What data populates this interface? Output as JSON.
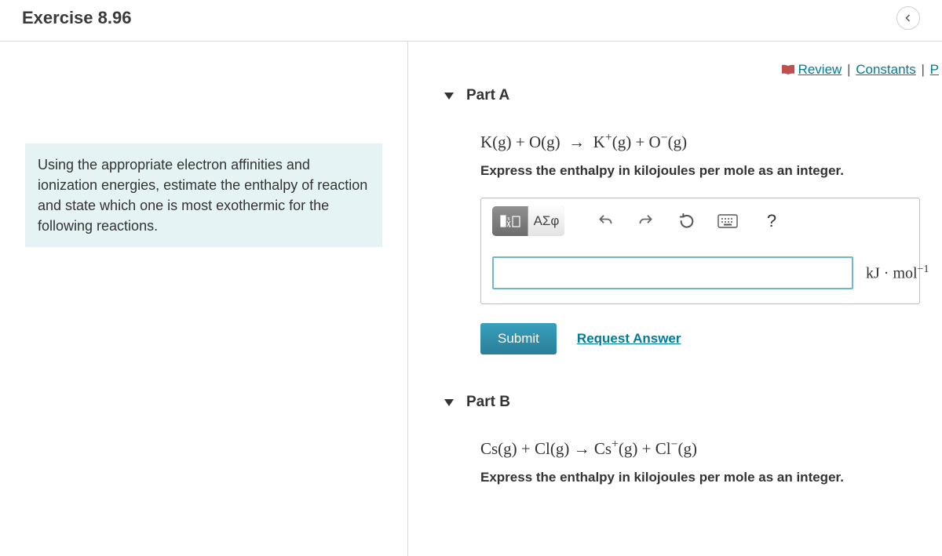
{
  "header": {
    "title": "Exercise 8.96"
  },
  "top_links": {
    "review": "Review",
    "constants": "Constants",
    "periodic_initial": "P"
  },
  "prompt": "Using the appropriate electron affinities and ionization energies, estimate the enthalpy of reaction and state which one is most exothermic for the following reactions.",
  "partA": {
    "label": "Part A",
    "equation_html": "K(g) + O(g) &nbsp;&rarr;&nbsp; K<sup>+</sup>(g) + O<sup>&minus;</sup>(g)",
    "instruction": "Express the enthalpy in kilojoules per mole as an integer.",
    "toolbar": {
      "templates_label": "templates",
      "symbols_label": "ΑΣφ"
    },
    "unit_html": "kJ &middot; mol<sup>&minus;1</sup>",
    "answer_value": "",
    "submit": "Submit",
    "request": "Request Answer"
  },
  "partB": {
    "label": "Part B",
    "equation_html": "Cs(g) + Cl(g) &rarr; Cs<sup>+</sup>(g) + Cl<sup>&minus;</sup>(g)",
    "instruction": "Express the enthalpy in kilojoules per mole as an integer."
  }
}
